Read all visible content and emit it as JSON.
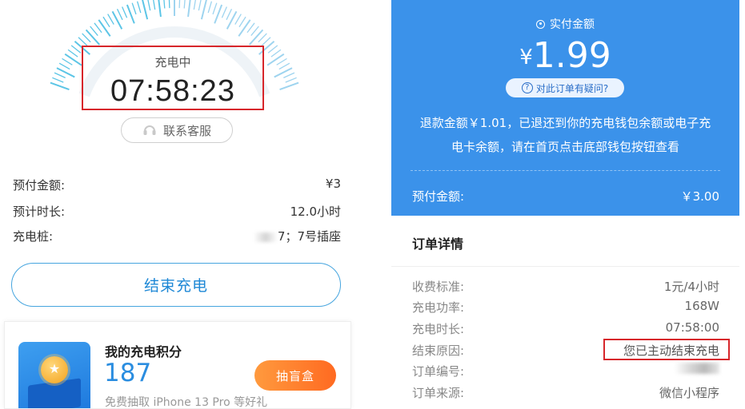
{
  "left": {
    "timer": {
      "status": "充电中",
      "value": "07:58:23"
    },
    "support_button": "联系客服",
    "info": [
      {
        "label": "预付金额:",
        "value": "¥3"
      },
      {
        "label": "预计时长:",
        "value": "12.0小时"
      },
      {
        "label": "充电桩:",
        "value": "7；7号插座"
      }
    ],
    "end_button": "结束充电",
    "points": {
      "title": "我的充电积分",
      "value": "187",
      "button": "抽盲盒",
      "desc": "免费抽取 iPhone 13 Pro 等好礼"
    }
  },
  "right": {
    "paid_label": "实付金额",
    "paid_currency": "¥",
    "paid_amount": "1.99",
    "question_link": "对此订单有疑问?",
    "refund_line1": "退款金额￥1.01，已退还到你的充电钱包余额或电子充",
    "refund_line2": "电卡余额，请在首页点击底部钱包按钮查看",
    "prepaid_label": "预付金额:",
    "prepaid_value": "￥3.00",
    "detail_title": "订单详情",
    "details": [
      {
        "label": "收费标准:",
        "value": "1元/4小时"
      },
      {
        "label": "充电功率:",
        "value": "168W"
      },
      {
        "label": "充电时长:",
        "value": "07:58:00"
      },
      {
        "label": "结束原因:",
        "value": "您已主动结束充电"
      },
      {
        "label": "订单编号:",
        "value": ""
      },
      {
        "label": "订单来源:",
        "value": "微信小程序"
      }
    ]
  },
  "colors": {
    "accent_blue": "#3b92ea",
    "timer_highlight": "#d7262b",
    "end_button_text": "#1e88d6",
    "points_value": "#2a8de0",
    "blind_box_button": "#ff7a2a"
  }
}
